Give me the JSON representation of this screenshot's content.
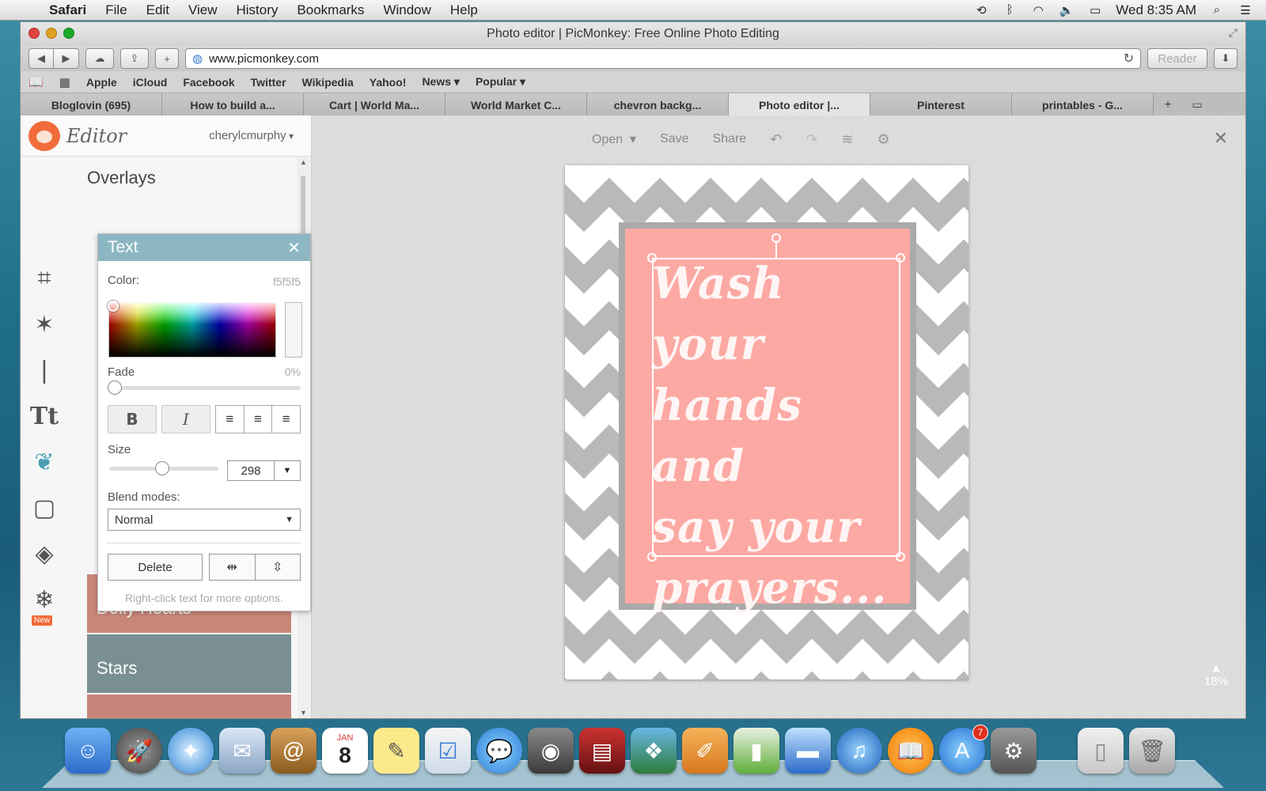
{
  "menubar": {
    "app": "Safari",
    "items": [
      "File",
      "Edit",
      "View",
      "History",
      "Bookmarks",
      "Window",
      "Help"
    ],
    "clock": "Wed 8:35 AM"
  },
  "window": {
    "title": "Photo editor | PicMonkey: Free Online Photo Editing",
    "url": "www.picmonkey.com",
    "reader_label": "Reader"
  },
  "bookmarks": [
    "Apple",
    "iCloud",
    "Facebook",
    "Twitter",
    "Wikipedia",
    "Yahoo!",
    "News ▾",
    "Popular ▾"
  ],
  "tabs": [
    {
      "label": "Bloglovin (695)",
      "active": false
    },
    {
      "label": "How to build a...",
      "active": false
    },
    {
      "label": "Cart | World Ma...",
      "active": false
    },
    {
      "label": "World Market C...",
      "active": false
    },
    {
      "label": "chevron backg...",
      "active": false
    },
    {
      "label": "Photo editor |...",
      "active": true
    },
    {
      "label": "Pinterest",
      "active": false
    },
    {
      "label": "printables - G...",
      "active": false
    }
  ],
  "editor": {
    "title": "Editor",
    "user": "cherylcmurphy",
    "panel_title": "Overlays",
    "overlay_tiles": [
      {
        "label": "Doily Hearts",
        "color": "#c9877a"
      },
      {
        "label": "Stars",
        "color": "#7a8f93"
      }
    ],
    "new_badge": "New"
  },
  "text_palette": {
    "title": "Text",
    "color_label": "Color:",
    "color_value": "f5f5f5",
    "fade_label": "Fade",
    "fade_value": "0%",
    "fade_level": 0,
    "bold": "B",
    "italic": "I",
    "size_label": "Size",
    "size_value": "298",
    "blend_label": "Blend modes:",
    "blend_value": "Normal",
    "delete_label": "Delete",
    "hint": "Right-click text for more options."
  },
  "canvas_toolbar": {
    "open": "Open",
    "save": "Save",
    "share": "Share"
  },
  "document": {
    "lines": [
      "Wash your",
      "hands",
      "and",
      "say your",
      "prayers..."
    ],
    "pink": "#fca9a3",
    "chevron_grey": "#b9b9b9"
  },
  "zoom": "18%",
  "dock": {
    "app_store_badge": "7",
    "calendar_month": "JAN",
    "calendar_day": "8"
  }
}
